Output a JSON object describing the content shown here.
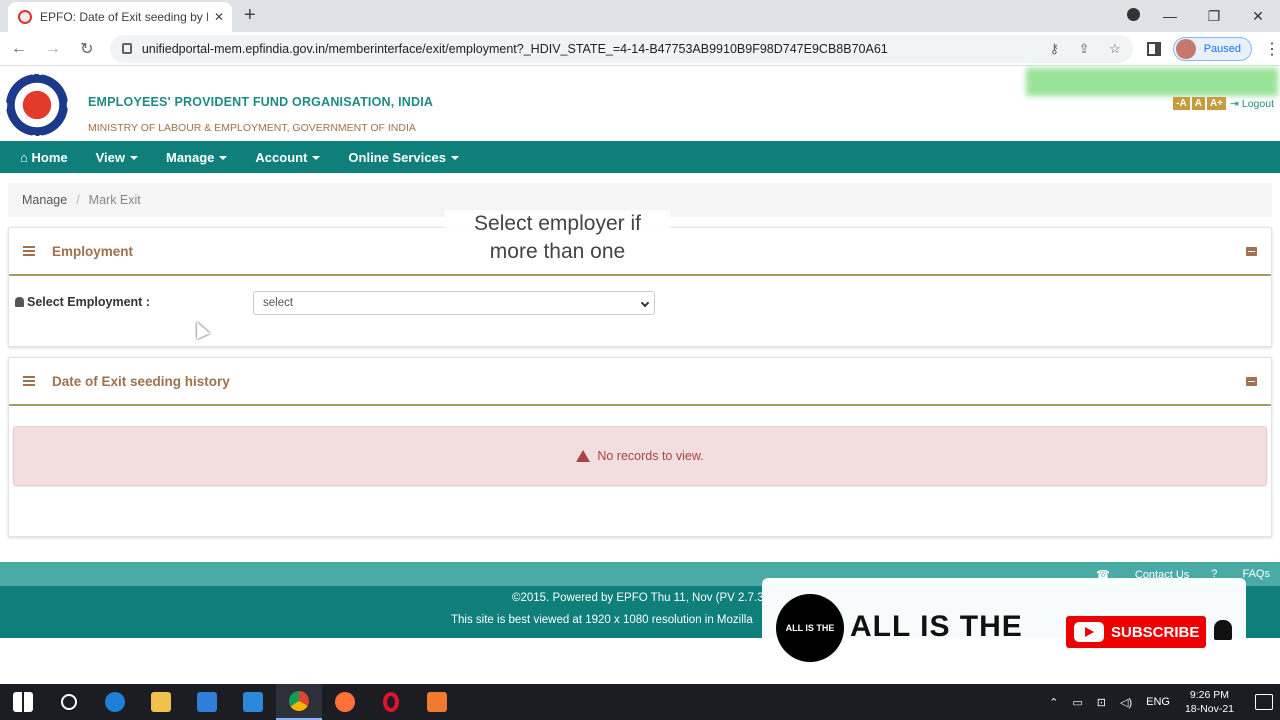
{
  "browser": {
    "tab_title": "EPFO: Date of Exit seeding by Me",
    "url": "unifiedportal-mem.epfindia.gov.in/memberinterface/exit/employment?_HDIV_STATE_=4-14-B47753AB9910B9F98D747E9CB8B70A61",
    "profile_status": "Paused"
  },
  "header": {
    "org_name": "EMPLOYEES' PROVIDENT FUND ORGANISATION, INDIA",
    "ministry": "MINISTRY OF LABOUR & EMPLOYMENT, GOVERNMENT OF INDIA",
    "font_controls": [
      "-A",
      "A",
      "A+"
    ],
    "logout": "Logout"
  },
  "nav": {
    "home": "Home",
    "view": "View",
    "manage": "Manage",
    "account": "Account",
    "online_services": "Online Services"
  },
  "breadcrumb": {
    "parent": "Manage",
    "current": "Mark Exit"
  },
  "employment_panel": {
    "title": "Employment",
    "label": "Select Employment :",
    "select_value": "select"
  },
  "overlay": {
    "line1": "Select employer if",
    "line2": "more than one"
  },
  "history_panel": {
    "title": "Date of Exit seeding history",
    "empty_message": "No records to view."
  },
  "footer": {
    "contact": "Contact Us",
    "faqs": "FAQs",
    "copyright": "©2015. Powered by EPFO Thu 11, Nov (PV 2.7.3",
    "best_view": "This site is best viewed at 1920 x 1080 resolution in Mozilla"
  },
  "subscribe_overlay": {
    "circle_text": "ALL IS THE",
    "brand": "ALL IS THE",
    "button": "SUBSCRIBE"
  },
  "taskbar": {
    "lang": "ENG",
    "time": "9:26 PM",
    "date": "18-Nov-21"
  }
}
